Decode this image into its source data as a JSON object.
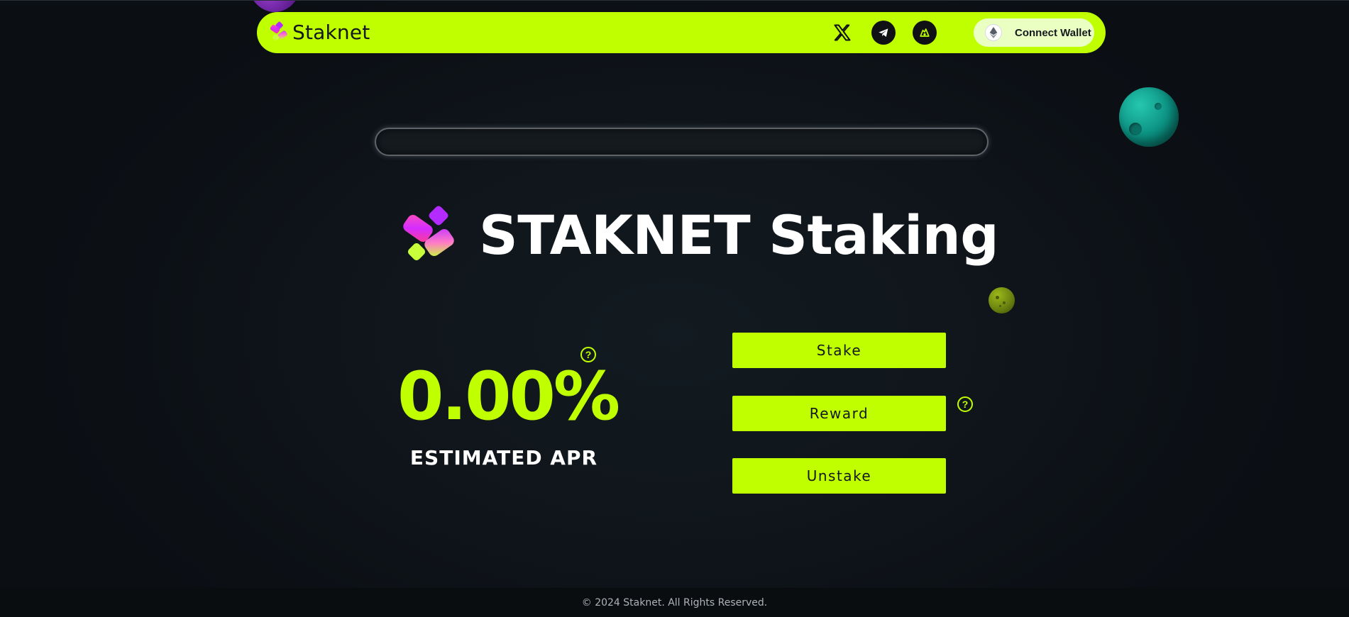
{
  "navbar": {
    "brand_name": "Staknet",
    "social": [
      {
        "icon": "x-twitter-icon"
      },
      {
        "icon": "telegram-icon"
      },
      {
        "icon": "dextools-icon"
      }
    ],
    "connect_wallet_label": "Connect Wallet",
    "connect_wallet_icon": "ethereum-icon"
  },
  "progress": {
    "fill_fraction": 0
  },
  "hero": {
    "title": "STAKNET Staking"
  },
  "apr": {
    "value": "0.00%",
    "label": "ESTIMATED APR",
    "help_symbol": "?"
  },
  "actions": {
    "stake_label": "Stake",
    "reward_label": "Reward",
    "unstake_label": "Unstake",
    "reward_help_symbol": "?"
  },
  "footer": {
    "copyright": "© 2024 Staknet. All Rights Reserved."
  },
  "colors": {
    "accent": "#bfff00",
    "background": "#0f151b",
    "text_light": "#ffffff",
    "connect_button_bg": "#eaffc2"
  }
}
